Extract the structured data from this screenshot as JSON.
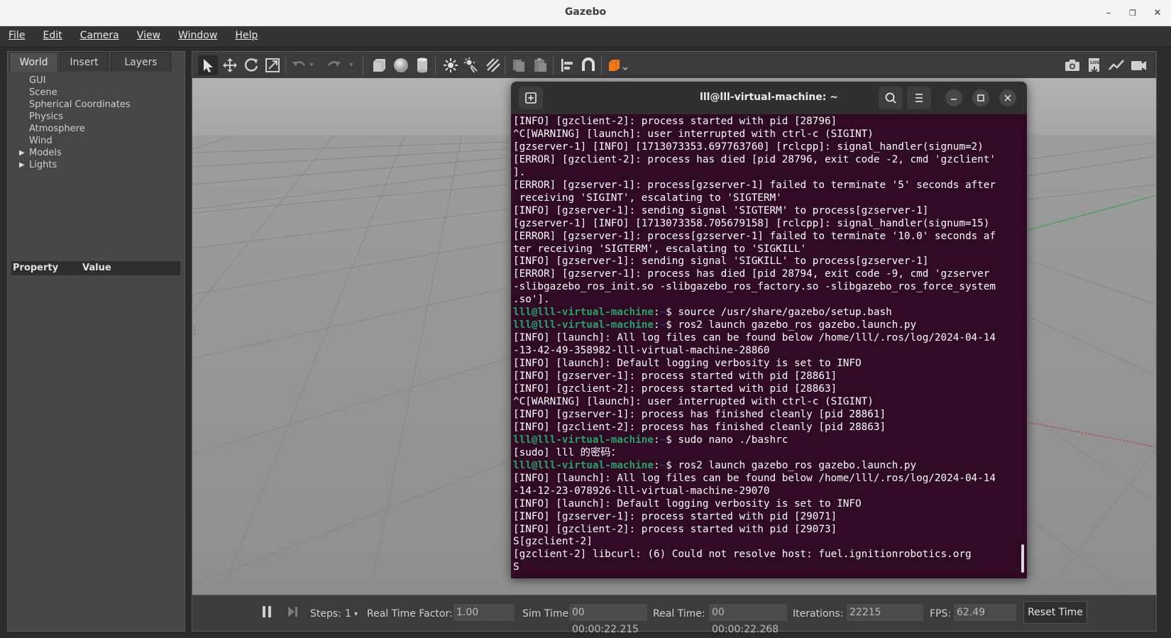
{
  "window": {
    "title": "Gazebo",
    "controls": {
      "minimize": "–",
      "maximize": "❐",
      "close": "✕"
    }
  },
  "menu": [
    "File",
    "Edit",
    "Camera",
    "View",
    "Window",
    "Help"
  ],
  "left_panel": {
    "tabs": [
      "World",
      "Insert",
      "Layers"
    ],
    "active_tab": "World",
    "tree": [
      {
        "label": "GUI",
        "expandable": false
      },
      {
        "label": "Scene",
        "expandable": false
      },
      {
        "label": "Spherical Coordinates",
        "expandable": false
      },
      {
        "label": "Physics",
        "expandable": false
      },
      {
        "label": "Atmosphere",
        "expandable": false
      },
      {
        "label": "Wind",
        "expandable": false
      },
      {
        "label": "Models",
        "expandable": true
      },
      {
        "label": "Lights",
        "expandable": true
      }
    ],
    "property_header": {
      "property": "Property",
      "value": "Value"
    }
  },
  "toolbar": {
    "icons": [
      "select-arrow-icon",
      "translate-icon",
      "rotate-icon",
      "scale-icon",
      "undo-icon",
      "undo-dropdown-icon",
      "redo-icon",
      "redo-dropdown-icon",
      "box-icon",
      "sphere-icon",
      "cylinder-icon",
      "point-light-icon",
      "spot-light-icon",
      "directional-light-icon",
      "copy-icon",
      "paste-icon",
      "align-icon",
      "snap-icon",
      "view-angle-icon",
      "screenshot-icon",
      "log-icon",
      "plot-icon",
      "video-icon"
    ],
    "accent": "#f07c1e"
  },
  "terminal": {
    "title": "lll@lll-virtual-machine: ~",
    "prompt_user": "lll@lll-virtual-machine",
    "prompt_sep": ":",
    "prompt_path": "~",
    "prompt_color": "#26a269",
    "background": "#300a24",
    "lines": [
      {
        "type": "out",
        "text": "[INFO] [gzclient-2]: process started with pid [28796]"
      },
      {
        "type": "out",
        "text": "^C[WARNING] [launch]: user interrupted with ctrl-c (SIGINT)"
      },
      {
        "type": "out",
        "text": "[gzserver-1] [INFO] [1713073353.697763760] [rclcpp]: signal_handler(signum=2)"
      },
      {
        "type": "out",
        "text": "[ERROR] [gzclient-2]: process has died [pid 28796, exit code -2, cmd 'gzclient'"
      },
      {
        "type": "out",
        "text": "]."
      },
      {
        "type": "out",
        "text": "[ERROR] [gzserver-1]: process[gzserver-1] failed to terminate '5' seconds after"
      },
      {
        "type": "out",
        "text": " receiving 'SIGINT', escalating to 'SIGTERM'"
      },
      {
        "type": "out",
        "text": "[INFO] [gzserver-1]: sending signal 'SIGTERM' to process[gzserver-1]"
      },
      {
        "type": "out",
        "text": "[gzserver-1] [INFO] [1713073358.705679158] [rclcpp]: signal_handler(signum=15)"
      },
      {
        "type": "out",
        "text": "[ERROR] [gzserver-1]: process[gzserver-1] failed to terminate '10.0' seconds af"
      },
      {
        "type": "out",
        "text": "ter receiving 'SIGTERM', escalating to 'SIGKILL'"
      },
      {
        "type": "out",
        "text": "[INFO] [gzserver-1]: sending signal 'SIGKILL' to process[gzserver-1]"
      },
      {
        "type": "out",
        "text": "[ERROR] [gzserver-1]: process has died [pid 28794, exit code -9, cmd 'gzserver"
      },
      {
        "type": "out",
        "text": "-slibgazebo_ros_init.so -slibgazebo_ros_factory.so -slibgazebo_ros_force_system"
      },
      {
        "type": "out",
        "text": ".so']."
      },
      {
        "type": "prompt",
        "text": "$ source /usr/share/gazebo/setup.bash"
      },
      {
        "type": "prompt",
        "text": "$ ros2 launch gazebo_ros gazebo.launch.py"
      },
      {
        "type": "out",
        "text": "[INFO] [launch]: All log files can be found below /home/lll/.ros/log/2024-04-14"
      },
      {
        "type": "out",
        "text": "-13-42-49-358982-lll-virtual-machine-28860"
      },
      {
        "type": "out",
        "text": "[INFO] [launch]: Default logging verbosity is set to INFO"
      },
      {
        "type": "out",
        "text": "[INFO] [gzserver-1]: process started with pid [28861]"
      },
      {
        "type": "out",
        "text": "[INFO] [gzclient-2]: process started with pid [28863]"
      },
      {
        "type": "out",
        "text": "^C[WARNING] [launch]: user interrupted with ctrl-c (SIGINT)"
      },
      {
        "type": "out",
        "text": "[INFO] [gzserver-1]: process has finished cleanly [pid 28861]"
      },
      {
        "type": "out",
        "text": "[INFO] [gzclient-2]: process has finished cleanly [pid 28863]"
      },
      {
        "type": "prompt",
        "text": "$ sudo nano ./bashrc"
      },
      {
        "type": "out",
        "text": "[sudo] lll 的密码："
      },
      {
        "type": "prompt",
        "text": "$ ros2 launch gazebo_ros gazebo.launch.py"
      },
      {
        "type": "out",
        "text": "[INFO] [launch]: All log files can be found below /home/lll/.ros/log/2024-04-14"
      },
      {
        "type": "out",
        "text": "-14-12-23-078926-lll-virtual-machine-29070"
      },
      {
        "type": "out",
        "text": "[INFO] [launch]: Default logging verbosity is set to INFO"
      },
      {
        "type": "out",
        "text": "[INFO] [gzserver-1]: process started with pid [29071]"
      },
      {
        "type": "out",
        "text": "[INFO] [gzclient-2]: process started with pid [29073]"
      },
      {
        "type": "out",
        "text": "S[gzclient-2]"
      },
      {
        "type": "out",
        "text": "[gzclient-2] libcurl: (6) Could not resolve host: fuel.ignitionrobotics.org"
      },
      {
        "type": "out",
        "text": "S"
      }
    ]
  },
  "bottom_bar": {
    "steps_label": "Steps:",
    "steps_value": "1",
    "rtf_label": "Real Time Factor:",
    "rtf_value": "1.00",
    "sim_time_label": "Sim Time:",
    "sim_time_value": "00 00:00:22.215",
    "real_time_label": "Real Time:",
    "real_time_value": "00 00:00:22.268",
    "iterations_label": "Iterations:",
    "iterations_value": "22215",
    "fps_label": "FPS:",
    "fps_value": "62.49",
    "reset_label": "Reset Time"
  }
}
